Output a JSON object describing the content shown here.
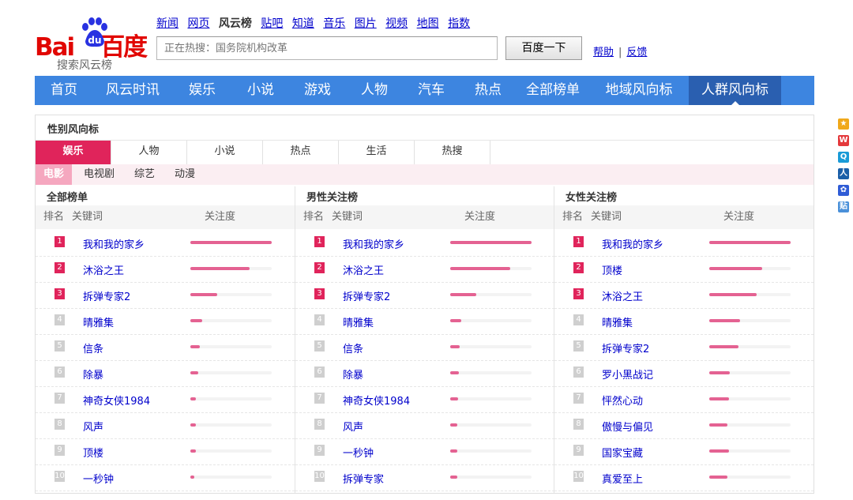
{
  "header": {
    "logo_text": "Bai du 百度",
    "logo_sub": "搜索风云榜",
    "topnav": [
      "新闻",
      "网页",
      "风云榜",
      "贴吧",
      "知道",
      "音乐",
      "图片",
      "视频",
      "地图",
      "指数"
    ],
    "topnav_current": "风云榜",
    "search_placeholder": "正在热搜：国务院机构改革",
    "search_button": "百度一下",
    "help": "帮助",
    "help_sep": "|",
    "feedback": "反馈"
  },
  "mainnav": {
    "items": [
      "首页",
      "风云时讯",
      "娱乐",
      "小说",
      "游戏",
      "人物",
      "汽车",
      "热点",
      "全部榜单",
      "地域风向标",
      "人群风向标"
    ],
    "active": "人群风向标"
  },
  "panel": {
    "title": "性别风向标",
    "tabs1": [
      "娱乐",
      "人物",
      "小说",
      "热点",
      "生活",
      "热搜"
    ],
    "tabs1_active": "娱乐",
    "tabs2": [
      "电影",
      "电视剧",
      "综艺",
      "动漫"
    ],
    "tabs2_active": "电影",
    "col_headers": {
      "rank": "排名",
      "keyword": "关键词",
      "attention": "关注度"
    },
    "columns": [
      {
        "title": "全部榜单",
        "rows": [
          {
            "rank": "1",
            "kw": "我和我的家乡",
            "pct": 100
          },
          {
            "rank": "2",
            "kw": "沐浴之王",
            "pct": 73
          },
          {
            "rank": "3",
            "kw": "拆弹专家2",
            "pct": 33
          },
          {
            "rank": "4",
            "kw": "晴雅集",
            "pct": 15
          },
          {
            "rank": "5",
            "kw": "信条",
            "pct": 12
          },
          {
            "rank": "6",
            "kw": "除暴",
            "pct": 10
          },
          {
            "rank": "7",
            "kw": "神奇女侠1984",
            "pct": 7
          },
          {
            "rank": "8",
            "kw": "风声",
            "pct": 7
          },
          {
            "rank": "9",
            "kw": "顶楼",
            "pct": 7
          },
          {
            "rank": "10",
            "kw": "一秒钟",
            "pct": 5
          }
        ]
      },
      {
        "title": "男性关注榜",
        "rows": [
          {
            "rank": "1",
            "kw": "我和我的家乡",
            "pct": 100
          },
          {
            "rank": "2",
            "kw": "沐浴之王",
            "pct": 74
          },
          {
            "rank": "3",
            "kw": "拆弹专家2",
            "pct": 32
          },
          {
            "rank": "4",
            "kw": "晴雅集",
            "pct": 14
          },
          {
            "rank": "5",
            "kw": "信条",
            "pct": 12
          },
          {
            "rank": "6",
            "kw": "除暴",
            "pct": 11
          },
          {
            "rank": "7",
            "kw": "神奇女侠1984",
            "pct": 10
          },
          {
            "rank": "8",
            "kw": "风声",
            "pct": 9
          },
          {
            "rank": "9",
            "kw": "一秒钟",
            "pct": 9
          },
          {
            "rank": "10",
            "kw": "拆弹专家",
            "pct": 9
          }
        ]
      },
      {
        "title": "女性关注榜",
        "rows": [
          {
            "rank": "1",
            "kw": "我和我的家乡",
            "pct": 100
          },
          {
            "rank": "2",
            "kw": "顶楼",
            "pct": 65
          },
          {
            "rank": "3",
            "kw": "沐浴之王",
            "pct": 58
          },
          {
            "rank": "4",
            "kw": "晴雅集",
            "pct": 38
          },
          {
            "rank": "5",
            "kw": "拆弹专家2",
            "pct": 36
          },
          {
            "rank": "6",
            "kw": "罗小黑战记",
            "pct": 25
          },
          {
            "rank": "7",
            "kw": "怦然心动",
            "pct": 24
          },
          {
            "rank": "8",
            "kw": "傲慢与偏见",
            "pct": 22
          },
          {
            "rank": "9",
            "kw": "国家宝藏",
            "pct": 24
          },
          {
            "rank": "10",
            "kw": "真爱至上",
            "pct": 22
          }
        ]
      }
    ]
  },
  "sidebar_icons": [
    {
      "name": "qzone-share-icon",
      "color": "#f0a81a",
      "glyph": "★"
    },
    {
      "name": "weibo-share-icon",
      "color": "#e4393c",
      "glyph": "W"
    },
    {
      "name": "tencent-weibo-share-icon",
      "color": "#1a9bd7",
      "glyph": "Q"
    },
    {
      "name": "renren-share-icon",
      "color": "#1b5fa8",
      "glyph": "人"
    },
    {
      "name": "baidu-share-icon",
      "color": "#2f5cd6",
      "glyph": "✿"
    },
    {
      "name": "tieba-share-icon",
      "color": "#4a90d9",
      "glyph": "贴"
    }
  ]
}
